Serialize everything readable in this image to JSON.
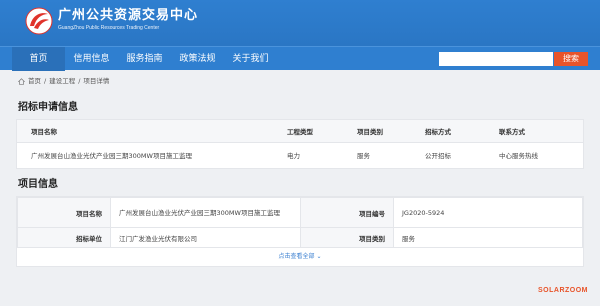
{
  "header": {
    "title": "广州公共资源交易中心",
    "subtitle": "GuangZhou Public Resources Trading Center"
  },
  "nav": {
    "items": [
      "首页",
      "信用信息",
      "服务指南",
      "政策法规",
      "关于我们"
    ],
    "search_placeholder": "",
    "search_label": "搜索"
  },
  "breadcrumb": {
    "home": "首页",
    "sep": "/",
    "level1": "建设工程",
    "level2": "项目详情"
  },
  "tender": {
    "title": "招标申请信息",
    "headers": [
      "项目名称",
      "工程类型",
      "项目类别",
      "招标方式",
      "联系方式"
    ],
    "row": [
      "广州发展台山渔业光伏产业园三期300MW项目施工监理",
      "电力",
      "服务",
      "公开招标",
      "中心服务热线"
    ]
  },
  "project": {
    "title": "项目信息",
    "name_label": "项目名称",
    "name_value": "广州发展台山渔业光伏产业园三期300MW项目施工监理",
    "code_label": "项目编号",
    "code_value": "JG2020-5924",
    "owner_label": "招标单位",
    "owner_value": "江门广发渔业光伏有限公司",
    "category_label": "项目类别",
    "category_value": "服务",
    "more_label": "点击查看全部 ⌄"
  },
  "watermark": "SOLARZOOM",
  "colors": {
    "header_blue": "#2f7fd0",
    "search_orange": "#e8542a",
    "logo_red": "#e0332b"
  }
}
